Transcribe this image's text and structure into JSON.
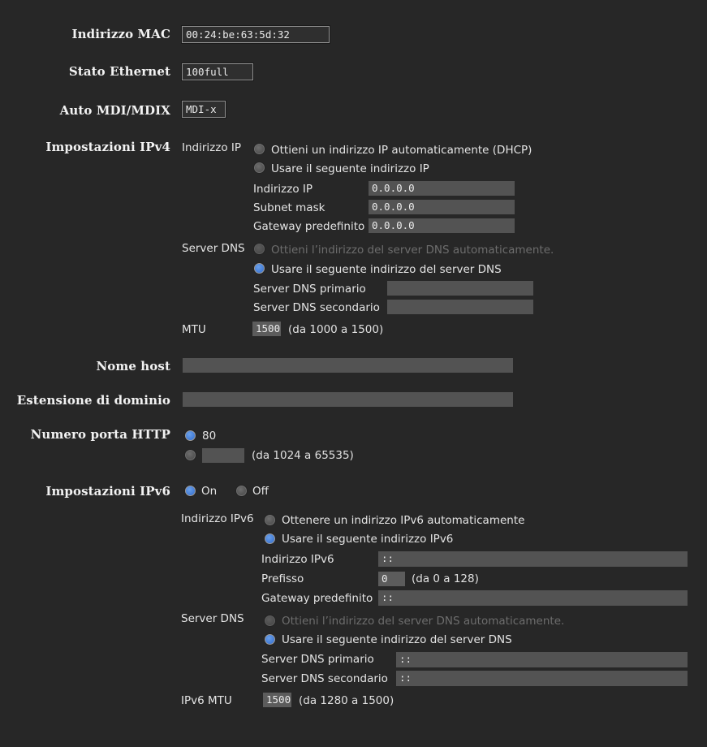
{
  "theme": {
    "background": "#272727",
    "text": "#e9e9e9",
    "dim_text": "#6d6d6d",
    "field_bg": "#535353",
    "radio_on": "#4a83da"
  },
  "rows": {
    "mac": {
      "label": "Indirizzo MAC",
      "value": "00:24:be:63:5d:32"
    },
    "ethernet": {
      "label": "Stato Ethernet",
      "value": "100full"
    },
    "mdi": {
      "label": "Auto MDI/MDIX",
      "value": "MDI-x"
    },
    "ipv4": {
      "label": "Impostazioni IPv4",
      "ip_address": {
        "label": "Indirizzo IP",
        "options": [
          {
            "text": "Ottieni un indirizzo IP automaticamente (DHCP)",
            "selected": false,
            "disabled": false
          },
          {
            "text": "Usare il seguente indirizzo IP",
            "selected": true,
            "disabled": false
          }
        ],
        "fields": [
          {
            "label": "Indirizzo IP",
            "value": "0.0.0.0"
          },
          {
            "label": "Subnet mask",
            "value": "0.0.0.0"
          },
          {
            "label": "Gateway predefinito",
            "value": "0.0.0.0"
          }
        ]
      },
      "dns": {
        "label": "Server DNS",
        "options": [
          {
            "text": "Ottieni l’indirizzo del server DNS automaticamente.",
            "selected": false,
            "disabled": true
          },
          {
            "text": "Usare il seguente indirizzo del server DNS",
            "selected": true,
            "disabled": false
          }
        ],
        "fields": [
          {
            "label": "Server DNS primario",
            "value": ""
          },
          {
            "label": "Server DNS secondario",
            "value": ""
          }
        ]
      },
      "mtu": {
        "label": "MTU",
        "value": "1500",
        "hint": "(da 1000 a 1500)"
      }
    },
    "hostname": {
      "label": "Nome host",
      "value": ""
    },
    "domain": {
      "label": "Estensione di dominio",
      "value": ""
    },
    "http_port": {
      "label": "Numero porta HTTP",
      "option_default": {
        "text": "80",
        "selected": true
      },
      "option_custom": {
        "value": "",
        "selected": false,
        "hint": "(da 1024 a 65535)"
      }
    },
    "ipv6": {
      "label": "Impostazioni IPv6",
      "toggle": [
        {
          "text": "On",
          "selected": true
        },
        {
          "text": "Off",
          "selected": false
        }
      ],
      "address": {
        "label": "Indirizzo IPv6",
        "options": [
          {
            "text": "Ottenere un indirizzo IPv6 automaticamente",
            "selected": false,
            "disabled": false
          },
          {
            "text": "Usare il seguente indirizzo IPv6",
            "selected": true,
            "disabled": false
          }
        ],
        "fields": [
          {
            "label": "Indirizzo IPv6",
            "value": "::"
          },
          {
            "label": "Prefisso",
            "value": "0",
            "hint": "(da 0 a 128)"
          },
          {
            "label": "Gateway predefinito",
            "value": "::"
          }
        ]
      },
      "dns": {
        "label": "Server DNS",
        "options": [
          {
            "text": "Ottieni l’indirizzo del server DNS automaticamente.",
            "selected": false,
            "disabled": true
          },
          {
            "text": "Usare il seguente indirizzo del server DNS",
            "selected": true,
            "disabled": false
          }
        ],
        "fields": [
          {
            "label": "Server DNS primario",
            "value": "::"
          },
          {
            "label": "Server DNS secondario",
            "value": "::"
          }
        ]
      },
      "mtu": {
        "label": "IPv6 MTU",
        "value": "1500",
        "hint": "(da 1280 a 1500)"
      }
    }
  }
}
